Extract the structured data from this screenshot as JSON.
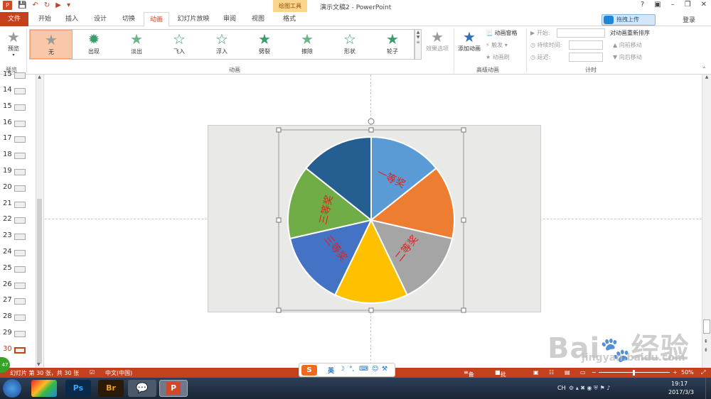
{
  "app": {
    "title": "演示文稿2 - PowerPoint",
    "context_tab": "绘图工具",
    "login": "登录",
    "upload": "拖拽上传"
  },
  "tabs": [
    "文件",
    "开始",
    "插入",
    "设计",
    "切换",
    "动画",
    "幻灯片放映",
    "审阅",
    "视图",
    "格式"
  ],
  "active_tab": "动画",
  "ribbon": {
    "preview": {
      "label": "预览",
      "group": "预览"
    },
    "animations": [
      {
        "label": "无",
        "selected": true,
        "color": "#9a9a9a"
      },
      {
        "label": "出现",
        "selected": false,
        "color": "#3d9c6b"
      },
      {
        "label": "淡出",
        "selected": false,
        "color": "#6ab58a"
      },
      {
        "label": "飞入",
        "selected": false,
        "color": "#3d9c6b"
      },
      {
        "label": "浮入",
        "selected": false,
        "color": "#3d9c6b"
      },
      {
        "label": "劈裂",
        "selected": false,
        "color": "#3d9c6b"
      },
      {
        "label": "擦除",
        "selected": false,
        "color": "#6ab58a"
      },
      {
        "label": "形状",
        "selected": false,
        "color": "#3d9c6b"
      },
      {
        "label": "轮子",
        "selected": false,
        "color": "#3d9c6b"
      }
    ],
    "effect_options": "效果选项",
    "animation_group": "动画",
    "add_animation": "添加动画",
    "animation_pane": "动画窗格",
    "trigger": "触发",
    "anim_painter": "动画刷",
    "advanced_group": "高级动画",
    "start": "开始:",
    "duration": "持续时间:",
    "delay": "延迟:",
    "reorder_title": "对动画重新排序",
    "move_earlier": "向前移动",
    "move_later": "向后移动",
    "timing_group": "计时"
  },
  "slides": {
    "numbers": [
      "15",
      "14",
      "15",
      "16",
      "17",
      "18",
      "19",
      "20",
      "21",
      "22",
      "23",
      "24",
      "25",
      "26",
      "27",
      "28",
      "29",
      "30"
    ],
    "current": "30"
  },
  "pie": {
    "slices": [
      {
        "color": "#5b9bd5",
        "label": "一等奖"
      },
      {
        "color": "#ed7d31",
        "label": ""
      },
      {
        "color": "#a5a5a5",
        "label": "二等奖"
      },
      {
        "color": "#ffc000",
        "label": ""
      },
      {
        "color": "#4472c4",
        "label": "三等奖"
      },
      {
        "color": "#70ad47",
        "label": "三等奖"
      },
      {
        "color": "#255e91",
        "label": ""
      }
    ],
    "label_color": "#e02020"
  },
  "status": {
    "slide_info": "幻灯片 第 30 张，共 30 张",
    "language": "中文(中国)",
    "notes": "备注",
    "comments": "批注",
    "zoom": "50%",
    "badge": "47"
  },
  "ime": {
    "lang": "英"
  },
  "tray": {
    "ch": "CH",
    "time": "19:17",
    "date": "2017/3/3"
  },
  "watermark": {
    "brand": "Bai",
    "brand2": "经验",
    "url": "jingyan.baidu.com"
  }
}
